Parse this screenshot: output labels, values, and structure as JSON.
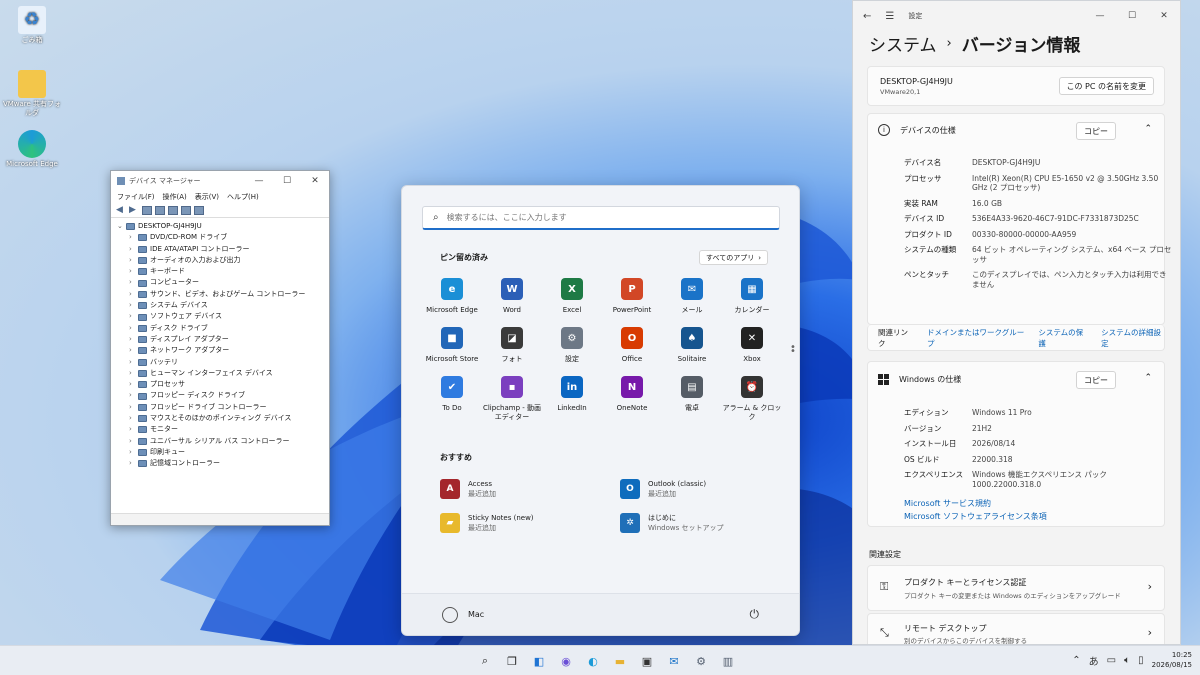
{
  "desktop": {
    "icons": [
      {
        "label": "ごみ箱"
      },
      {
        "label": "VMware 共有フォルダ"
      },
      {
        "label": "Microsoft Edge"
      }
    ]
  },
  "devmgr": {
    "title": "デバイス マネージャー",
    "menu": [
      "ファイル(F)",
      "操作(A)",
      "表示(V)",
      "ヘルプ(H)"
    ],
    "root": "DESKTOP-GJ4H9JU",
    "nodes": [
      "DVD/CD-ROM ドライブ",
      "IDE ATA/ATAPI コントローラー",
      "オーディオの入力および出力",
      "キーボード",
      "コンピューター",
      "サウンド、ビデオ、およびゲーム コントローラー",
      "システム デバイス",
      "ソフトウェア デバイス",
      "ディスク ドライブ",
      "ディスプレイ アダプター",
      "ネットワーク アダプター",
      "バッテリ",
      "ヒューマン インターフェイス デバイス",
      "プロセッサ",
      "フロッピー ディスク ドライブ",
      "フロッピー ドライブ コントローラー",
      "マウスとそのほかのポインティング デバイス",
      "モニター",
      "ユニバーサル シリアル バス コントローラー",
      "印刷キュー",
      "記憶域コントローラー"
    ]
  },
  "start": {
    "search_placeholder": "検索するには、ここに入力します",
    "pinned_title": "ピン留め済み",
    "all_apps": "すべてのアプリ",
    "pinned": [
      {
        "label": "Microsoft Edge",
        "color": "#1b8fd6",
        "glyph": "e"
      },
      {
        "label": "Word",
        "color": "#2b5fb7",
        "glyph": "W"
      },
      {
        "label": "Excel",
        "color": "#1e7a45",
        "glyph": "X"
      },
      {
        "label": "PowerPoint",
        "color": "#d24726",
        "glyph": "P"
      },
      {
        "label": "メール",
        "color": "#1a73c8",
        "glyph": "✉"
      },
      {
        "label": "カレンダー",
        "color": "#1a73c8",
        "glyph": "▦"
      },
      {
        "label": "Microsoft Store",
        "color": "#2166b8",
        "glyph": "■"
      },
      {
        "label": "フォト",
        "color": "#3a3a3a",
        "glyph": "◪"
      },
      {
        "label": "設定",
        "color": "#6d7886",
        "glyph": "⚙"
      },
      {
        "label": "Office",
        "color": "#d83b01",
        "glyph": "O"
      },
      {
        "label": "Solitaire",
        "color": "#16558f",
        "glyph": "♠"
      },
      {
        "label": "Xbox",
        "color": "#222222",
        "glyph": "✕"
      },
      {
        "label": "To Do",
        "color": "#2f7be0",
        "glyph": "✔"
      },
      {
        "label": "Clipchamp - 動画エディター",
        "color": "#7b3fbf",
        "glyph": "▪"
      },
      {
        "label": "LinkedIn",
        "color": "#0a66c2",
        "glyph": "in"
      },
      {
        "label": "OneNote",
        "color": "#7719aa",
        "glyph": "N"
      },
      {
        "label": "電卓",
        "color": "#555c66",
        "glyph": "▤"
      },
      {
        "label": "アラーム & クロック",
        "color": "#333333",
        "glyph": "⏰"
      }
    ],
    "recommended_title": "おすすめ",
    "recommended": [
      {
        "title": "Access",
        "sub": "最近追加",
        "color": "#a4262c",
        "glyph": "A"
      },
      {
        "title": "Outlook (classic)",
        "sub": "最近追加",
        "color": "#0f6cbd",
        "glyph": "O"
      },
      {
        "title": "Sticky Notes (new)",
        "sub": "最近追加",
        "color": "#e8b92c",
        "glyph": "▰"
      },
      {
        "title": "はじめに",
        "sub": "Windows セットアップ",
        "color": "#1f6fb8",
        "glyph": "✲"
      }
    ],
    "user": "Mac"
  },
  "settings": {
    "app_title": "設定",
    "breadcrumb_parent": "システム",
    "breadcrumb_current": "バージョン情報",
    "device_name": "DESKTOP-GJ4H9JU",
    "device_model": "VMware20,1",
    "rename_button": "この PC の名前を変更",
    "device_spec_title": "デバイスの仕様",
    "copy_label": "コピー",
    "device_specs": [
      {
        "k": "デバイス名",
        "v": "DESKTOP-GJ4H9JU"
      },
      {
        "k": "プロセッサ",
        "v": "Intel(R) Xeon(R) CPU E5-1650 v2 @ 3.50GHz 3.50 GHz (2 プロセッサ)"
      },
      {
        "k": "実装 RAM",
        "v": "16.0 GB"
      },
      {
        "k": "デバイス ID",
        "v": "536E4A33-9620-46C7-91DC-F7331873D25C"
      },
      {
        "k": "プロダクト ID",
        "v": "00330-80000-00000-AA959"
      },
      {
        "k": "システムの種類",
        "v": "64 ビット オペレーティング システム、x64 ベース プロセッサ"
      },
      {
        "k": "ペンとタッチ",
        "v": "このディスプレイでは、ペン入力とタッチ入力は利用できません"
      }
    ],
    "related_links_label": "関連リンク",
    "related_links": [
      "ドメインまたはワークグループ",
      "システムの保護",
      "システムの詳細設定"
    ],
    "windows_spec_title": "Windows の仕様",
    "windows_specs": [
      {
        "k": "エディション",
        "v": "Windows 11 Pro"
      },
      {
        "k": "バージョン",
        "v": "21H2"
      },
      {
        "k": "インストール日",
        "v": "2026/08/14"
      },
      {
        "k": "OS ビルド",
        "v": "22000.318"
      },
      {
        "k": "エクスペリエンス",
        "v": "Windows 機能エクスペリエンス パック 1000.22000.318.0"
      }
    ],
    "service_agreement": "Microsoft サービス規約",
    "license_terms": "Microsoft ソフトウェアライセンス条項",
    "related_settings": "関連設定",
    "product_key_title": "プロダクト キーとライセンス認証",
    "product_key_sub": "プロダクト キーの変更または Windows のエディションをアップグレード",
    "remote_title": "リモート デスクトップ",
    "remote_sub": "別のデバイスからこのデバイスを制御する"
  },
  "taskbar": {
    "time": "10:25",
    "date": "2026/08/15",
    "ime": "あ"
  }
}
